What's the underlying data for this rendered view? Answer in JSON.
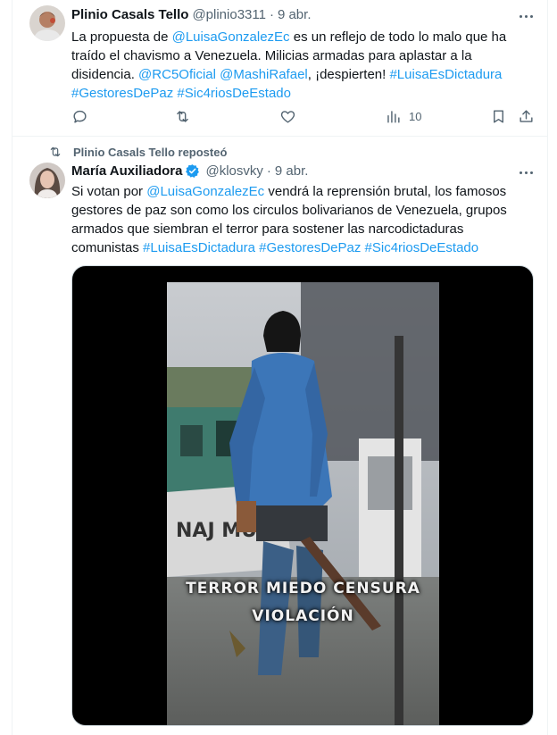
{
  "tweet1": {
    "name": "Plinio Casals Tello",
    "handle": "@plinio3311",
    "separator": "·",
    "date": "9 abr.",
    "text_parts": [
      {
        "t": "La propuesta de ",
        "link": false
      },
      {
        "t": "@LuisaGonzalezEc",
        "link": true
      },
      {
        "t": " es un reflejo de todo lo malo que ha\ntraído el chavismo a Venezuela. Milicias armadas para aplastar a la\ndisidencia. ",
        "link": false
      },
      {
        "t": "@RC5Oficial",
        "link": true
      },
      {
        "t": " ",
        "link": false
      },
      {
        "t": "@MashiRafael",
        "link": true
      },
      {
        "t": ", ¡despierten! ",
        "link": false
      },
      {
        "t": "#LuisaEsDictadura",
        "link": true
      },
      {
        "t": "\n",
        "link": false
      },
      {
        "t": "#GestoresDePaz",
        "link": true
      },
      {
        "t": " ",
        "link": false
      },
      {
        "t": "#Sic4riosDeEstado",
        "link": true
      }
    ],
    "views": "10"
  },
  "repost_label": "Plinio Casals Tello reposteó",
  "tweet2": {
    "name": "María Auxiliadora",
    "handle": "@klosvky",
    "separator": "·",
    "date": "9 abr.",
    "text_parts": [
      {
        "t": "Si votan por ",
        "link": false
      },
      {
        "t": "@LuisaGonzalezEc",
        "link": true
      },
      {
        "t": " vendrá la reprensión brutal, los famosos\ngestores de paz son como los circulos bolivarianos de Venezuela, grupos\narmados que siembran el terror para sostener las narcodictaduras\ncomunistas ",
        "link": false
      },
      {
        "t": "#LuisaEsDictadura",
        "link": true
      },
      {
        "t": " ",
        "link": false
      },
      {
        "t": "#GestoresDePaz",
        "link": true
      },
      {
        "t": " ",
        "link": false
      },
      {
        "t": "#Sic4riosDeEstado",
        "link": true
      }
    ],
    "video_caption_line1": "TERROR MIEDO CENSURA",
    "video_caption_line2": "VIOLACIÓN"
  },
  "colors": {
    "link": "#1d9bf0",
    "text": "#0f1419",
    "secondary": "#536471",
    "verified": "#1d9bf0"
  },
  "icons": [
    "reply-icon",
    "retweet-icon",
    "like-icon",
    "views-icon",
    "bookmark-icon",
    "share-icon",
    "more-icon",
    "verified-badge-icon"
  ]
}
